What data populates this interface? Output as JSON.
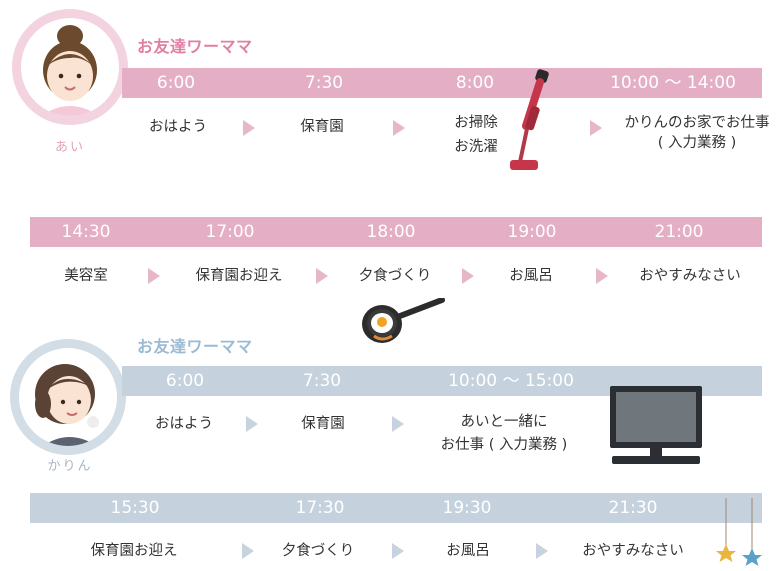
{
  "colors": {
    "pink_band": "#e4afc4",
    "blue_band": "#c5d2dd",
    "pink_text": "#e07fa4",
    "blue_text": "#9bbad4"
  },
  "ai": {
    "title": "お友達ワーママ",
    "name": "あい",
    "row1": {
      "times": [
        "6:00",
        "7:30",
        "8:00",
        "10:00 〜 14:00"
      ],
      "labels": [
        "おはよう",
        "保育園",
        "お掃除",
        "お洗濯",
        "かりんのお家でお仕事",
        "( 入力業務 )"
      ]
    },
    "row2": {
      "times": [
        "14:30",
        "17:00",
        "18:00",
        "19:00",
        "21:00"
      ],
      "labels": [
        "美容室",
        "保育園お迎え",
        "夕食づくり",
        "お風呂",
        "おやすみなさい"
      ]
    }
  },
  "karin": {
    "title": "お友達ワーママ",
    "name": "かりん",
    "row1": {
      "times": [
        "6:00",
        "7:30",
        "10:00 〜 15:00"
      ],
      "labels": [
        "おはよう",
        "保育園",
        "あいと一緒に",
        "お仕事 ( 入力業務 )"
      ]
    },
    "row2": {
      "times": [
        "15:30",
        "17:30",
        "19:30",
        "21:30"
      ],
      "labels": [
        "保育園お迎え",
        "夕食づくり",
        "お風呂",
        "おやすみなさい"
      ]
    }
  },
  "icons": {
    "vacuum": "vacuum-cleaner-icon",
    "pan": "frying-pan-egg-icon",
    "monitor": "computer-monitor-icon",
    "stars": "hanging-stars-icon"
  }
}
